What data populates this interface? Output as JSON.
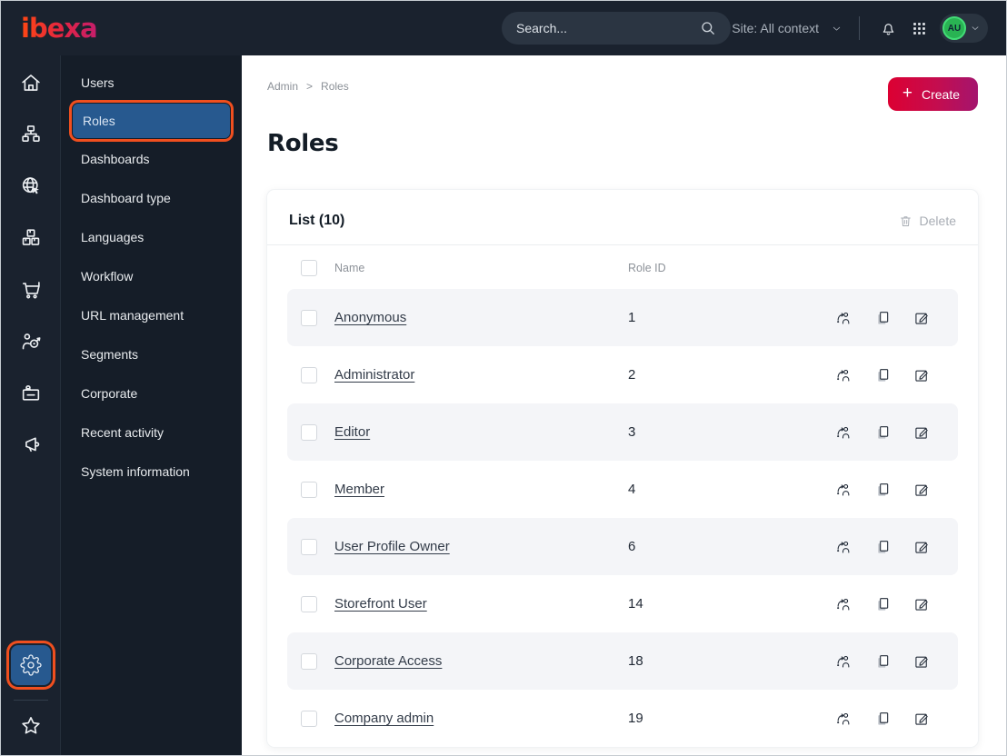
{
  "topbar": {
    "logo_text": "ibexa",
    "search_placeholder": "Search...",
    "site_context_label": "Site: All context",
    "avatar_initials": "AU"
  },
  "icon_rail": {
    "items": [
      "home",
      "content-tree",
      "site",
      "product-catalog",
      "commerce",
      "personalization",
      "corporate",
      "announcements"
    ],
    "active_bottom_item": "admin-settings"
  },
  "sidebar": {
    "items": [
      {
        "label": "Users",
        "selected": false
      },
      {
        "label": "Roles",
        "selected": true
      },
      {
        "label": "Dashboards",
        "selected": false
      },
      {
        "label": "Dashboard type",
        "selected": false
      },
      {
        "label": "Languages",
        "selected": false
      },
      {
        "label": "Workflow",
        "selected": false
      },
      {
        "label": "URL management",
        "selected": false
      },
      {
        "label": "Segments",
        "selected": false
      },
      {
        "label": "Corporate",
        "selected": false
      },
      {
        "label": "Recent activity",
        "selected": false
      },
      {
        "label": "System information",
        "selected": false
      }
    ]
  },
  "breadcrumb": {
    "items": [
      "Admin",
      "Roles"
    ],
    "separator": ">"
  },
  "page": {
    "title": "Roles",
    "create_button_label": "Create",
    "create_plus": "+"
  },
  "card": {
    "title": "List (10)",
    "delete_button_label": "Delete",
    "columns": {
      "name": "Name",
      "role_id": "Role ID"
    },
    "row_actions": [
      "assign-users",
      "copy",
      "edit"
    ],
    "rows": [
      {
        "name": "Anonymous",
        "role_id": "1"
      },
      {
        "name": "Administrator",
        "role_id": "2"
      },
      {
        "name": "Editor",
        "role_id": "3"
      },
      {
        "name": "Member",
        "role_id": "4"
      },
      {
        "name": "User Profile Owner",
        "role_id": "6"
      },
      {
        "name": "Storefront User",
        "role_id": "14"
      },
      {
        "name": "Corporate Access",
        "role_id": "18"
      },
      {
        "name": "Company admin",
        "role_id": "19"
      }
    ]
  },
  "colors": {
    "topbar_bg": "#1a222e",
    "menu_bg": "#151d28",
    "selected_blue": "#27598f",
    "annotation_orange": "#f04f1f",
    "create_gradient": [
      "#dc0032",
      "#a4156e"
    ],
    "avatar_green": "#29b353",
    "row_stripe": "#f4f5f8"
  }
}
